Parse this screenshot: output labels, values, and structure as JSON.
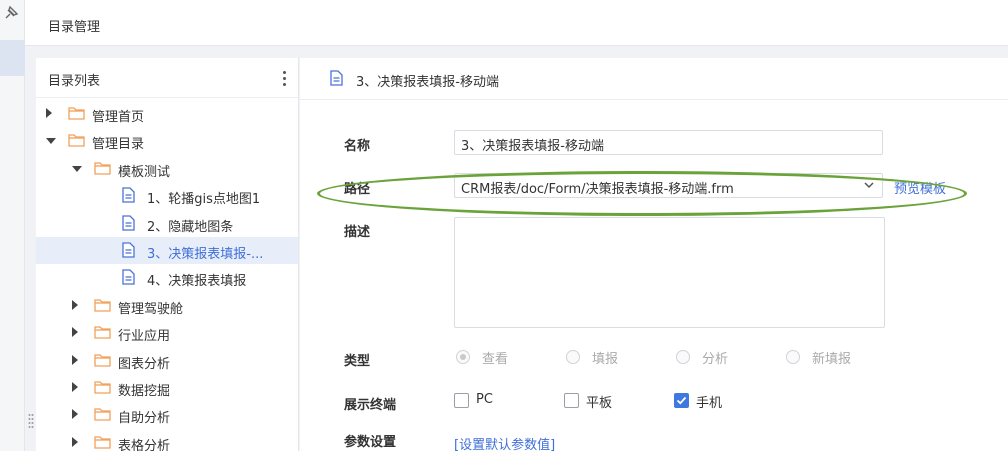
{
  "header": {
    "title": "目录管理"
  },
  "tree": {
    "title": "目录列表",
    "items": [
      {
        "label": "管理首页",
        "level": 0,
        "type": "folder",
        "expanded": false
      },
      {
        "label": "管理目录",
        "level": 0,
        "type": "folder",
        "expanded": true
      },
      {
        "label": "模板测试",
        "level": 1,
        "type": "folder",
        "expanded": true
      },
      {
        "label": "1、轮播gis点地图1",
        "level": 2,
        "type": "doc"
      },
      {
        "label": "2、隐藏地图条",
        "level": 2,
        "type": "doc"
      },
      {
        "label": "3、决策报表填报-...",
        "level": 2,
        "type": "doc",
        "selected": true
      },
      {
        "label": "4、决策报表填报",
        "level": 2,
        "type": "doc"
      },
      {
        "label": "管理驾驶舱",
        "level": 1,
        "type": "folder",
        "expanded": false
      },
      {
        "label": "行业应用",
        "level": 1,
        "type": "folder",
        "expanded": false
      },
      {
        "label": "图表分析",
        "level": 1,
        "type": "folder",
        "expanded": false
      },
      {
        "label": "数据挖掘",
        "level": 1,
        "type": "folder",
        "expanded": false
      },
      {
        "label": "自助分析",
        "level": 1,
        "type": "folder",
        "expanded": false
      },
      {
        "label": "表格分析",
        "level": 1,
        "type": "folder",
        "expanded": false
      }
    ]
  },
  "detail": {
    "title": "3、决策报表填报-移动端",
    "name_label": "名称",
    "name_value": "3、决策报表填报-移动端",
    "path_label": "路径",
    "path_value": "CRM报表/doc/Form/决策报表填报-移动端.frm",
    "preview_link": "预览模板",
    "desc_label": "描述",
    "type_label": "类型",
    "type_options": [
      "查看",
      "填报",
      "分析",
      "新填报"
    ],
    "terminal_label": "展示终端",
    "terminals": [
      {
        "label": "PC",
        "checked": false
      },
      {
        "label": "平板",
        "checked": false
      },
      {
        "label": "手机",
        "checked": true
      }
    ],
    "param_label": "参数设置",
    "param_link": "[设置默认参数值]"
  },
  "colors": {
    "accent": "#3f78e0",
    "folder": "#f0a15a",
    "doc": "#4a72d8",
    "highlight_ellipse": "#6aa33a"
  }
}
